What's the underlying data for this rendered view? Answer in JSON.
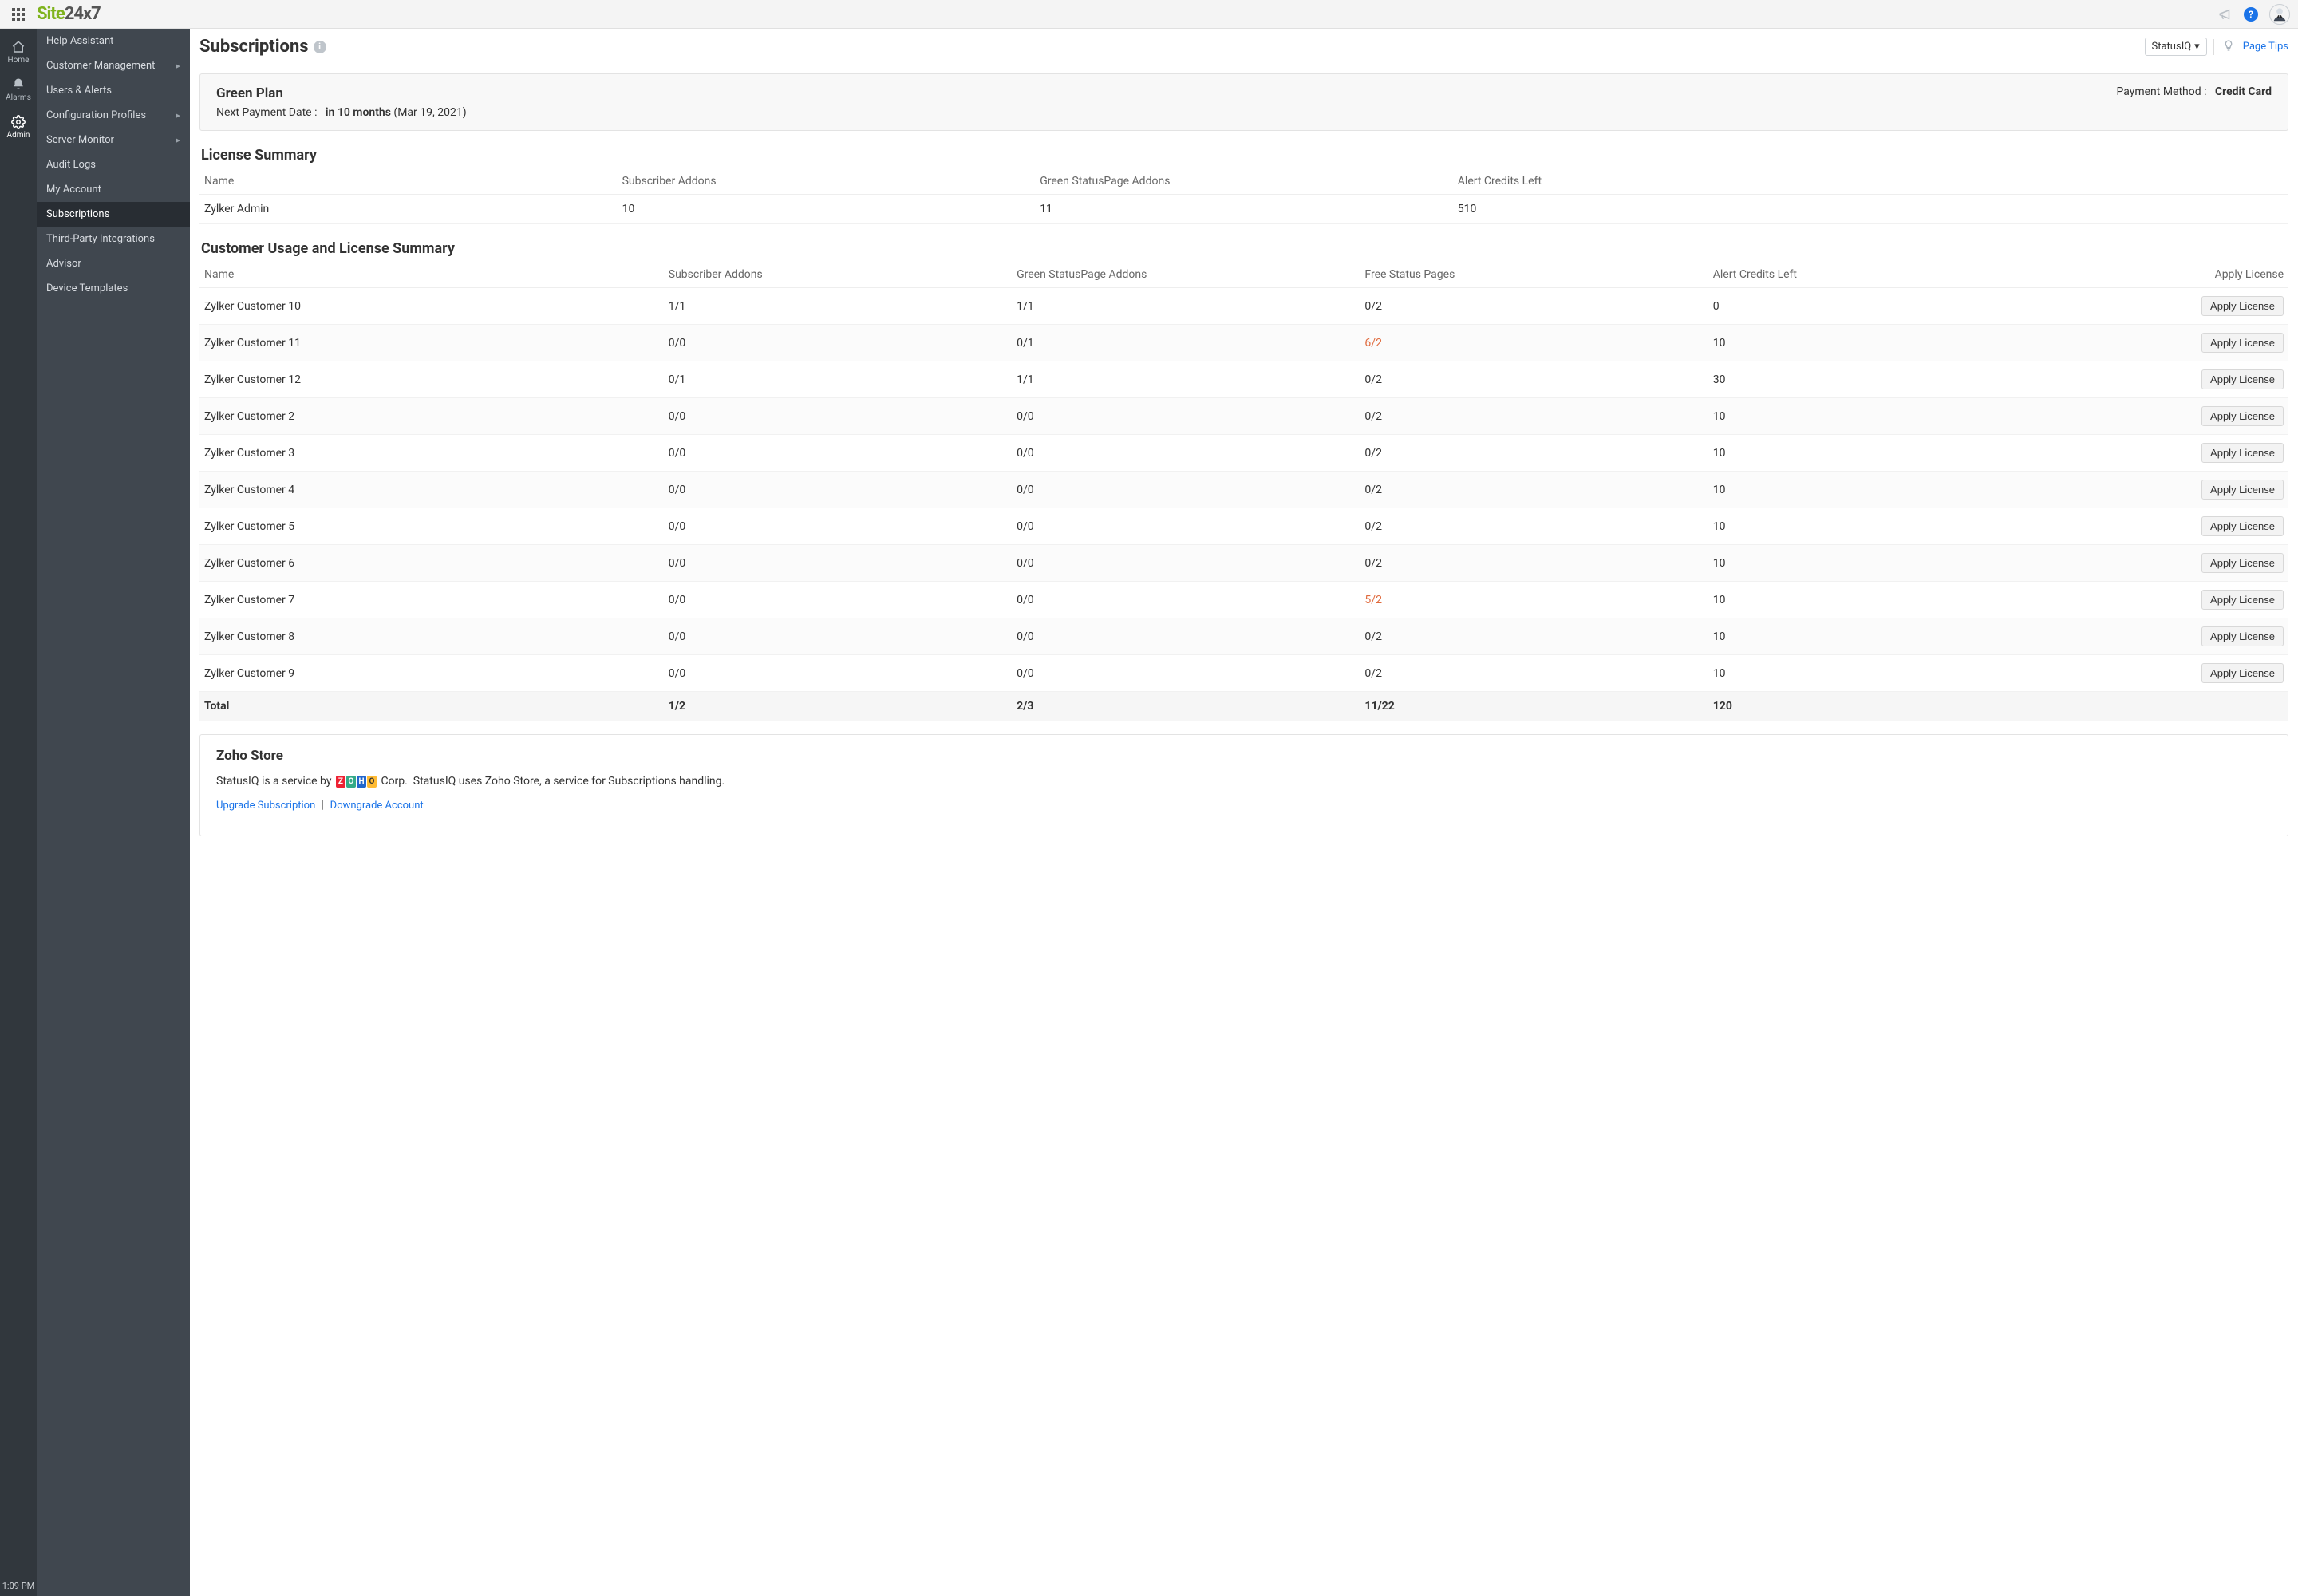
{
  "brand": {
    "a": "Site",
    "b": "24x7"
  },
  "rail": {
    "home": "Home",
    "alarms": "Alarms",
    "admin": "Admin",
    "time": "1:09 PM"
  },
  "sidebar": {
    "items": [
      {
        "label": "Help Assistant",
        "chev": false
      },
      {
        "label": "Customer Management",
        "chev": true
      },
      {
        "label": "Users & Alerts",
        "chev": false
      },
      {
        "label": "Configuration Profiles",
        "chev": true
      },
      {
        "label": "Server Monitor",
        "chev": true
      },
      {
        "label": "Audit Logs",
        "chev": false
      },
      {
        "label": "My Account",
        "chev": false
      },
      {
        "label": "Subscriptions",
        "chev": false,
        "active": true
      },
      {
        "label": "Third-Party Integrations",
        "chev": false
      },
      {
        "label": "Advisor",
        "chev": false
      },
      {
        "label": "Device Templates",
        "chev": false
      }
    ]
  },
  "page": {
    "title": "Subscriptions",
    "selector": "StatusIQ",
    "tips": "Page Tips"
  },
  "plan": {
    "name": "Green Plan",
    "np_label": "Next Payment Date :",
    "np_value": "in 10 months",
    "np_date": "(Mar 19, 2021)",
    "pm_label": "Payment Method :",
    "pm_value": "Credit Card"
  },
  "license": {
    "title": "License Summary",
    "headers": {
      "name": "Name",
      "sa": "Subscriber Addons",
      "ga": "Green StatusPage Addons",
      "ac": "Alert Credits Left"
    },
    "row": {
      "name": "Zylker Admin",
      "sa": "10",
      "ga": "11",
      "ac": "510"
    }
  },
  "usage": {
    "title": "Customer Usage and License Summary",
    "headers": {
      "name": "Name",
      "sa": "Subscriber Addons",
      "ga": "Green StatusPage Addons",
      "fsp": "Free Status Pages",
      "ac": "Alert Credits Left",
      "al": "Apply License"
    },
    "rows": [
      {
        "name": "Zylker Customer 10",
        "sa": "1/1",
        "ga": "1/1",
        "fsp": "0/2",
        "ac": "0",
        "btn": "Apply License"
      },
      {
        "name": "Zylker Customer 11",
        "sa": "0/0",
        "ga": "0/1",
        "fsp": "6/2",
        "fsp_red": true,
        "ac": "10",
        "btn": "Apply License"
      },
      {
        "name": "Zylker Customer 12",
        "sa": "0/1",
        "ga": "1/1",
        "fsp": "0/2",
        "ac": "30",
        "btn": "Apply License"
      },
      {
        "name": "Zylker Customer 2",
        "sa": "0/0",
        "ga": "0/0",
        "fsp": "0/2",
        "ac": "10",
        "btn": "Apply License"
      },
      {
        "name": "Zylker Customer 3",
        "sa": "0/0",
        "ga": "0/0",
        "fsp": "0/2",
        "ac": "10",
        "btn": "Apply License"
      },
      {
        "name": "Zylker Customer 4",
        "sa": "0/0",
        "ga": "0/0",
        "fsp": "0/2",
        "ac": "10",
        "btn": "Apply License"
      },
      {
        "name": "Zylker Customer 5",
        "sa": "0/0",
        "ga": "0/0",
        "fsp": "0/2",
        "ac": "10",
        "btn": "Apply License"
      },
      {
        "name": "Zylker Customer 6",
        "sa": "0/0",
        "ga": "0/0",
        "fsp": "0/2",
        "ac": "10",
        "btn": "Apply License"
      },
      {
        "name": "Zylker Customer 7",
        "sa": "0/0",
        "ga": "0/0",
        "fsp": "5/2",
        "fsp_red": true,
        "ac": "10",
        "btn": "Apply License"
      },
      {
        "name": "Zylker Customer 8",
        "sa": "0/0",
        "ga": "0/0",
        "fsp": "0/2",
        "ac": "10",
        "btn": "Apply License"
      },
      {
        "name": "Zylker Customer 9",
        "sa": "0/0",
        "ga": "0/0",
        "fsp": "0/2",
        "ac": "10",
        "btn": "Apply License"
      }
    ],
    "total": {
      "label": "Total",
      "sa": "1/2",
      "ga": "2/3",
      "fsp": "11/22",
      "ac": "120"
    }
  },
  "zoho": {
    "title": "Zoho Store",
    "line1a": "StatusIQ is a service by",
    "line1b": "Corp.  StatusIQ uses Zoho Store, a service for Subscriptions handling.",
    "upgrade": "Upgrade Subscription",
    "sep": "|",
    "downgrade": "Downgrade Account"
  }
}
